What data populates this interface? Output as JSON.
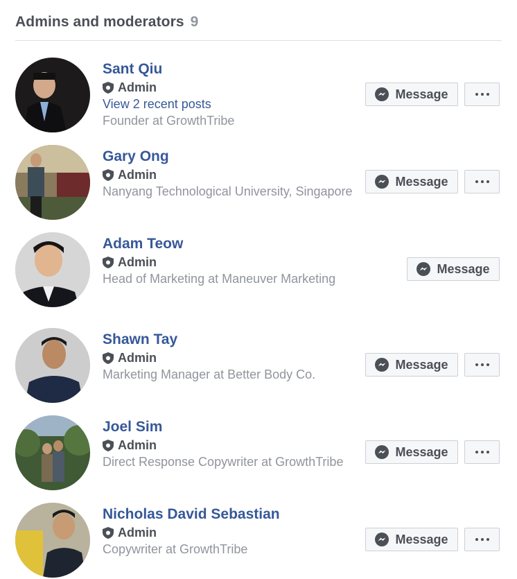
{
  "section": {
    "title": "Admins and moderators",
    "count": "9"
  },
  "buttons": {
    "message_label": "Message"
  },
  "icons": {
    "role": "shield-icon",
    "message": "messenger-icon",
    "more": "more-options-icon"
  },
  "colors": {
    "link": "#365899",
    "muted": "#90949c",
    "button_bg": "#f6f7f9",
    "button_border": "#ccd0d5"
  },
  "members": [
    {
      "name": "Sant Qiu",
      "role": "Admin",
      "link": "View 2 recent posts",
      "detail": "Founder at GrowthTribe",
      "has_more": true
    },
    {
      "name": "Gary Ong",
      "role": "Admin",
      "link": "",
      "detail": "Nanyang Technological University, Singapore",
      "has_more": true
    },
    {
      "name": "Adam Teow",
      "role": "Admin",
      "link": "",
      "detail": "Head of Marketing at Maneuver Marketing",
      "has_more": false
    },
    {
      "name": "Shawn Tay",
      "role": "Admin",
      "link": "",
      "detail": "Marketing Manager at Better Body Co.",
      "has_more": true
    },
    {
      "name": "Joel Sim",
      "role": "Admin",
      "link": "",
      "detail": "Direct Response Copywriter at GrowthTribe",
      "has_more": true
    },
    {
      "name": "Nicholas David Sebastian",
      "role": "Admin",
      "link": "",
      "detail": "Copywriter at GrowthTribe",
      "has_more": true
    }
  ]
}
